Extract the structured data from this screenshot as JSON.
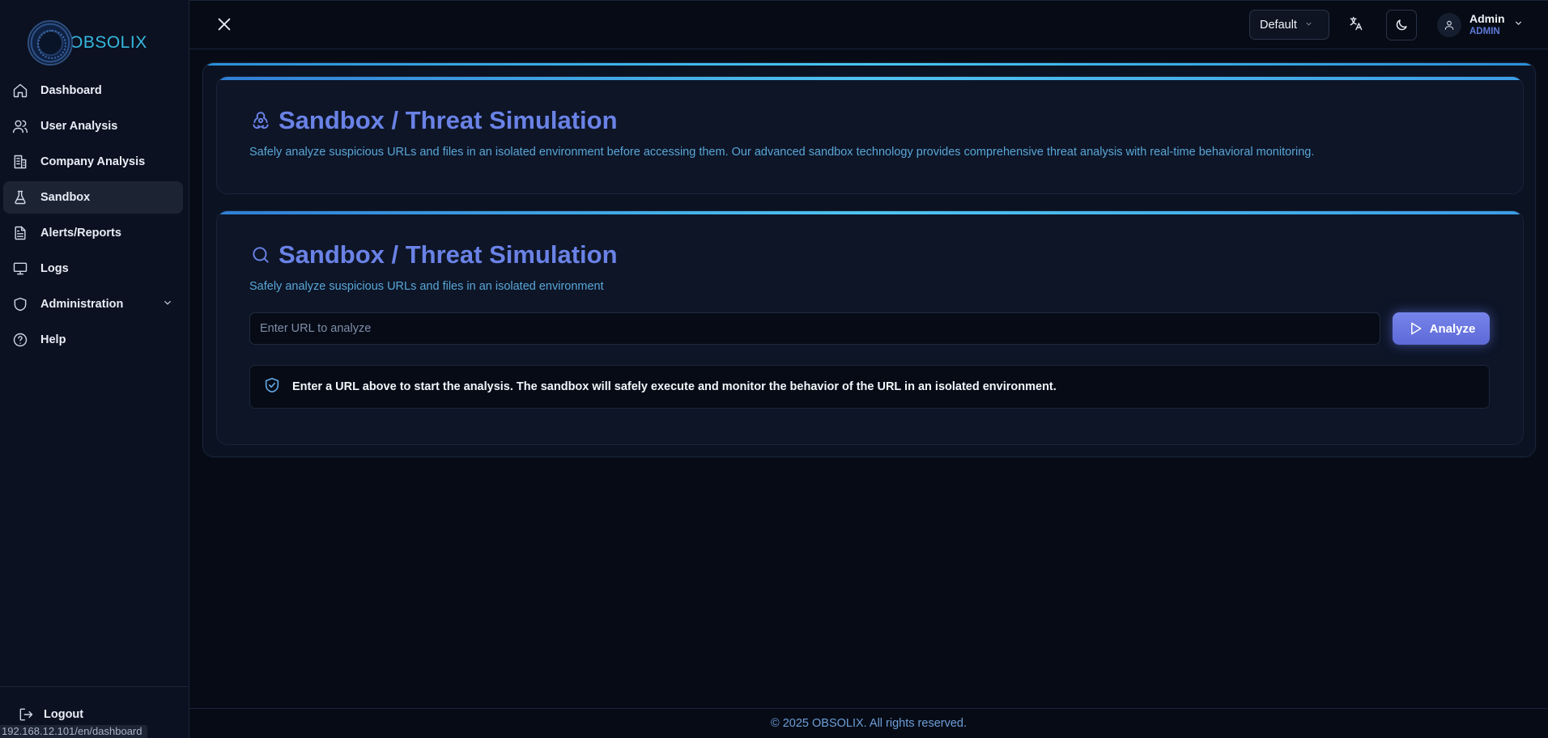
{
  "brand": {
    "name": "OBSOLIX"
  },
  "sidebar": {
    "items": [
      {
        "label": "Dashboard",
        "icon": "home-icon"
      },
      {
        "label": "User Analysis",
        "icon": "users-icon"
      },
      {
        "label": "Company Analysis",
        "icon": "building-icon"
      },
      {
        "label": "Sandbox",
        "icon": "flask-icon",
        "active": true
      },
      {
        "label": "Alerts/Reports",
        "icon": "file-text-icon"
      },
      {
        "label": "Logs",
        "icon": "monitor-icon"
      },
      {
        "label": "Administration",
        "icon": "shield-icon",
        "expandable": true
      },
      {
        "label": "Help",
        "icon": "help-circle-icon"
      }
    ],
    "logout_label": "Logout"
  },
  "status_url": "192.168.12.101/en/dashboard",
  "topbar": {
    "theme_select_value": "Default",
    "user": {
      "name": "Admin",
      "role": "ADMIN"
    }
  },
  "hero_card": {
    "title": "Sandbox / Threat Simulation",
    "description": "Safely analyze suspicious URLs and files in an isolated environment before accessing them. Our advanced sandbox technology provides comprehensive threat analysis with real-time behavioral monitoring.",
    "icon": "biohazard-icon"
  },
  "analysis_card": {
    "title": "Sandbox / Threat Simulation",
    "description": "Safely analyze suspicious URLs and files in an isolated environment",
    "icon": "search-icon",
    "url_input": {
      "value": "",
      "placeholder": "Enter URL to analyze"
    },
    "analyze_label": "Analyze",
    "info_text": "Enter a URL above to start the analysis. The sandbox will safely execute and monitor the behavior of the URL in an isolated environment."
  },
  "footer": {
    "text": "© 2025 OBSOLIX. All rights reserved."
  },
  "colors": {
    "accent": "#6a82e6",
    "accent_cyan": "#47c8f0",
    "background": "#060b16",
    "sidebar_bg": "#0b1120"
  }
}
